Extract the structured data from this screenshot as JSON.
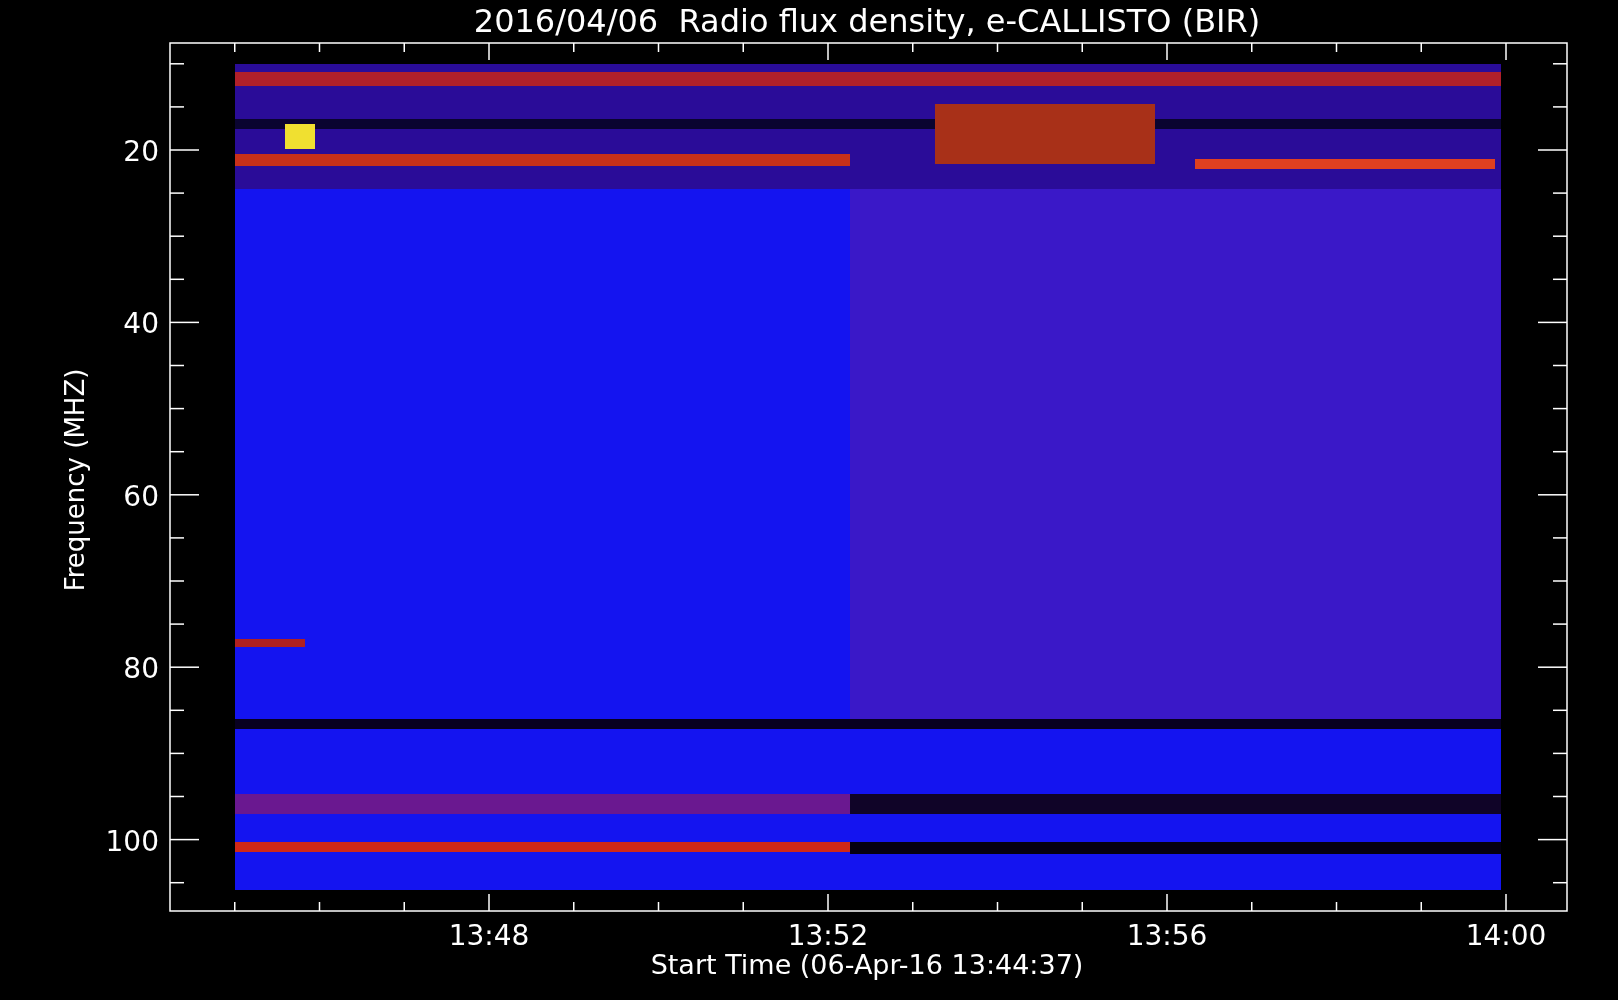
{
  "title": "2016/04/06  Radio flux density, e-CALLISTO (BIR)",
  "y_axis": {
    "label": "Frequency (MHZ)",
    "ticks": [
      "20",
      "40",
      "60",
      "80",
      "100"
    ]
  },
  "x_axis": {
    "label": "Start Time (06-Apr-16 13:44:37)",
    "ticks": [
      "13:48",
      "13:52",
      "13:56",
      "14:00"
    ]
  }
}
